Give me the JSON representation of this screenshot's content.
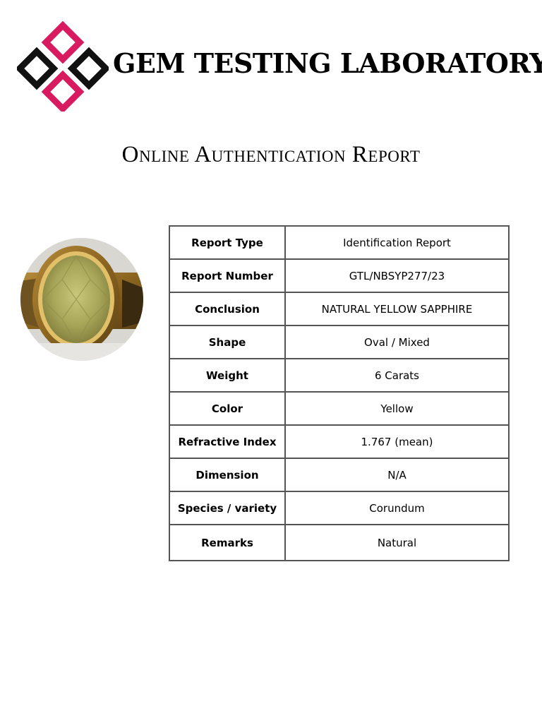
{
  "header": {
    "brand_name": "GEM TESTING LABORATORY",
    "colors": {
      "accent": "#d81b60",
      "dark": "#111111"
    }
  },
  "report": {
    "title": "Online Authentication Report"
  },
  "gem_image": {
    "icon": "ring-photo-icon",
    "subject": "yellow oval gemstone ring"
  },
  "table": {
    "rows": [
      {
        "label": "Report Type",
        "value": "Identification Report"
      },
      {
        "label": "Report Number",
        "value": "GTL/NBSYP277/23"
      },
      {
        "label": "Conclusion",
        "value": "NATURAL YELLOW SAPPHIRE"
      },
      {
        "label": "Shape",
        "value": "Oval / Mixed"
      },
      {
        "label": "Weight",
        "value": "6 Carats"
      },
      {
        "label": "Color",
        "value": "Yellow"
      },
      {
        "label": "Refractive Index",
        "value": "1.767 (mean)"
      },
      {
        "label": "Dimension",
        "value": "N/A"
      },
      {
        "label": "Species / variety",
        "value": "Corundum"
      },
      {
        "label": "Remarks",
        "value": "Natural"
      }
    ]
  }
}
